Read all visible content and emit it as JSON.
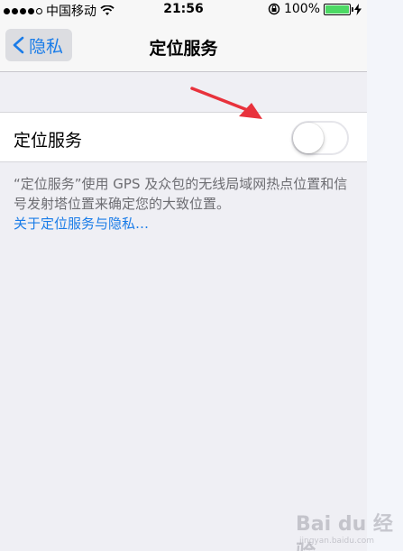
{
  "status_bar": {
    "carrier": "中国移动",
    "time": "21:56",
    "battery_percent": "100%",
    "battery_level": 1.0
  },
  "nav": {
    "back_label": "隐私",
    "title": "定位服务"
  },
  "location_cell": {
    "label": "定位服务",
    "toggle_on": false
  },
  "footer": {
    "description": "“定位服务”使用 GPS 及众包的无线局域网热点位置和信号发射塔位置来确定您的大致位置。",
    "link": "关于定位服务与隐私…"
  },
  "annotation": {
    "arrow_color": "#e8323c"
  },
  "watermark": {
    "text": "Bai du 经验",
    "sub": "jingyan.baidu.com"
  },
  "colors": {
    "accent": "#1a7ce8",
    "background": "#efeff4"
  }
}
